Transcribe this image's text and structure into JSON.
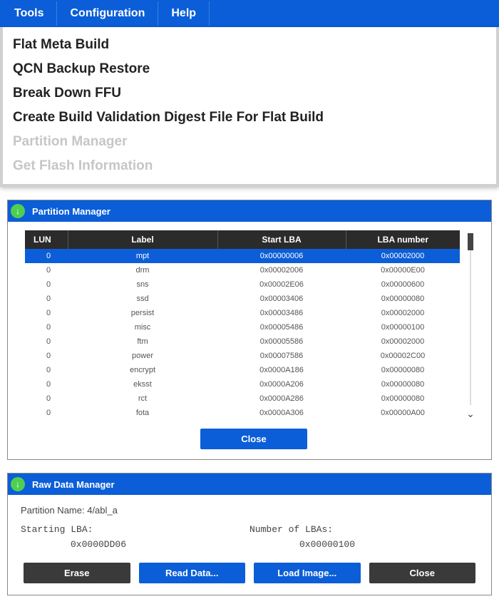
{
  "menubar": {
    "tools": "Tools",
    "configuration": "Configuration",
    "help": "Help"
  },
  "tools_menu": [
    {
      "label": "Flat Meta Build",
      "enabled": true
    },
    {
      "label": "QCN Backup Restore",
      "enabled": true
    },
    {
      "label": "Break Down FFU",
      "enabled": true
    },
    {
      "label": "Create Build Validation Digest File For Flat Build",
      "enabled": true
    },
    {
      "label": "Partition Manager",
      "enabled": false
    },
    {
      "label": "Get Flash Information",
      "enabled": false
    }
  ],
  "partition_panel": {
    "title": "Partition Manager",
    "columns": {
      "lun": "LUN",
      "label": "Label",
      "start_lba": "Start LBA",
      "lba_number": "LBA number"
    },
    "rows": [
      {
        "lun": "0",
        "label": "mpt",
        "start_lba": "0x00000006",
        "lba_number": "0x00002000",
        "selected": true
      },
      {
        "lun": "0",
        "label": "drm",
        "start_lba": "0x00002006",
        "lba_number": "0x00000E00"
      },
      {
        "lun": "0",
        "label": "sns",
        "start_lba": "0x00002E06",
        "lba_number": "0x00000600"
      },
      {
        "lun": "0",
        "label": "ssd",
        "start_lba": "0x00003406",
        "lba_number": "0x00000080"
      },
      {
        "lun": "0",
        "label": "persist",
        "start_lba": "0x00003486",
        "lba_number": "0x00002000"
      },
      {
        "lun": "0",
        "label": "misc",
        "start_lba": "0x00005486",
        "lba_number": "0x00000100"
      },
      {
        "lun": "0",
        "label": "ftm",
        "start_lba": "0x00005586",
        "lba_number": "0x00002000"
      },
      {
        "lun": "0",
        "label": "power",
        "start_lba": "0x00007586",
        "lba_number": "0x00002C00"
      },
      {
        "lun": "0",
        "label": "encrypt",
        "start_lba": "0x0000A186",
        "lba_number": "0x00000080"
      },
      {
        "lun": "0",
        "label": "eksst",
        "start_lba": "0x0000A206",
        "lba_number": "0x00000080"
      },
      {
        "lun": "0",
        "label": "rct",
        "start_lba": "0x0000A286",
        "lba_number": "0x00000080"
      },
      {
        "lun": "0",
        "label": "fota",
        "start_lba": "0x0000A306",
        "lba_number": "0x00000A00"
      }
    ],
    "close_label": "Close"
  },
  "raw_panel": {
    "title": "Raw Data Manager",
    "partition_label": "Partition Name:",
    "partition_value": "4/abl_a",
    "starting_lba_label": "Starting LBA:",
    "starting_lba_value": "0x0000DD06",
    "number_lbas_label": "Number of LBAs:",
    "number_lbas_value": "0x00000100",
    "buttons": {
      "erase": "Erase",
      "read_data": "Read Data...",
      "load_image": "Load Image...",
      "close": "Close"
    }
  }
}
